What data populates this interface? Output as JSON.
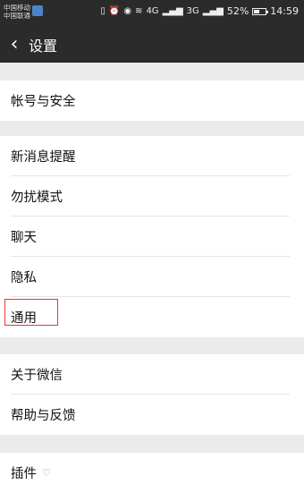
{
  "status_bar": {
    "carrier_1": "中国移动",
    "carrier_2": "中国联通",
    "signal_1_label": "4G",
    "signal_2_label": "3G",
    "battery_percent": "52%",
    "battery_level": 0.52,
    "time": "14:59",
    "icons": [
      "vibrate-icon",
      "alarm-icon",
      "eye-icon",
      "wifi-icon",
      "signal-icon",
      "signal-icon",
      "battery-icon"
    ]
  },
  "header": {
    "back_icon": "chevron-left-icon",
    "title": "设置"
  },
  "sections": [
    {
      "items": [
        {
          "label": "帐号与安全"
        }
      ]
    },
    {
      "items": [
        {
          "label": "新消息提醒"
        },
        {
          "label": "勿扰模式"
        },
        {
          "label": "聊天"
        },
        {
          "label": "隐私"
        },
        {
          "label": "通用",
          "highlighted": true
        }
      ]
    },
    {
      "items": [
        {
          "label": "关于微信"
        },
        {
          "label": "帮助与反馈"
        }
      ]
    },
    {
      "items": [
        {
          "label": "插件",
          "icon": "plugin-icon"
        }
      ]
    }
  ],
  "colors": {
    "bar_background": "#2b2b2b",
    "page_background": "#ebebeb",
    "highlight_border": "#e53935"
  }
}
